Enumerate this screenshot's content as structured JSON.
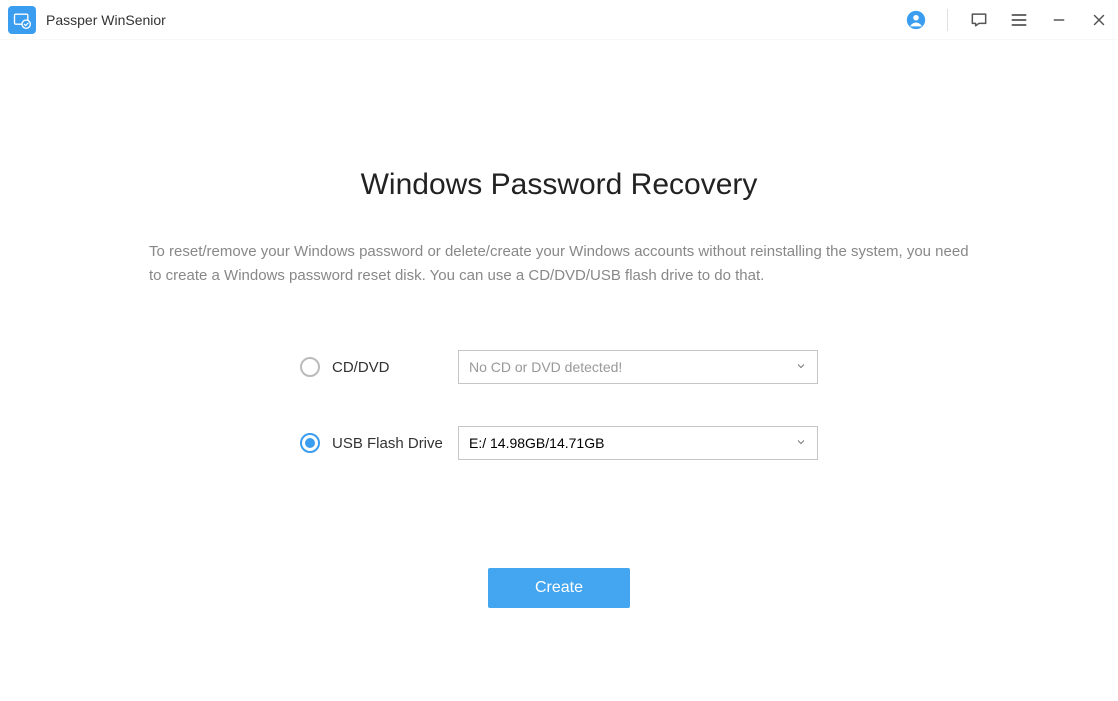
{
  "titlebar": {
    "app_name": "Passper WinSenior"
  },
  "main": {
    "heading": "Windows Password Recovery",
    "description": "To reset/remove your Windows password or delete/create your Windows accounts without reinstalling the system, you need to create a Windows password reset disk. You can use a CD/DVD/USB flash drive to do that.",
    "options": {
      "cd_dvd": {
        "label": "CD/DVD",
        "dropdown_value": "No CD or DVD detected!",
        "selected": false
      },
      "usb": {
        "label": "USB Flash Drive",
        "dropdown_value": "E:/ 14.98GB/14.71GB",
        "selected": true
      }
    },
    "create_button": "Create"
  },
  "colors": {
    "accent": "#3b9def",
    "button": "#44a6f0"
  }
}
